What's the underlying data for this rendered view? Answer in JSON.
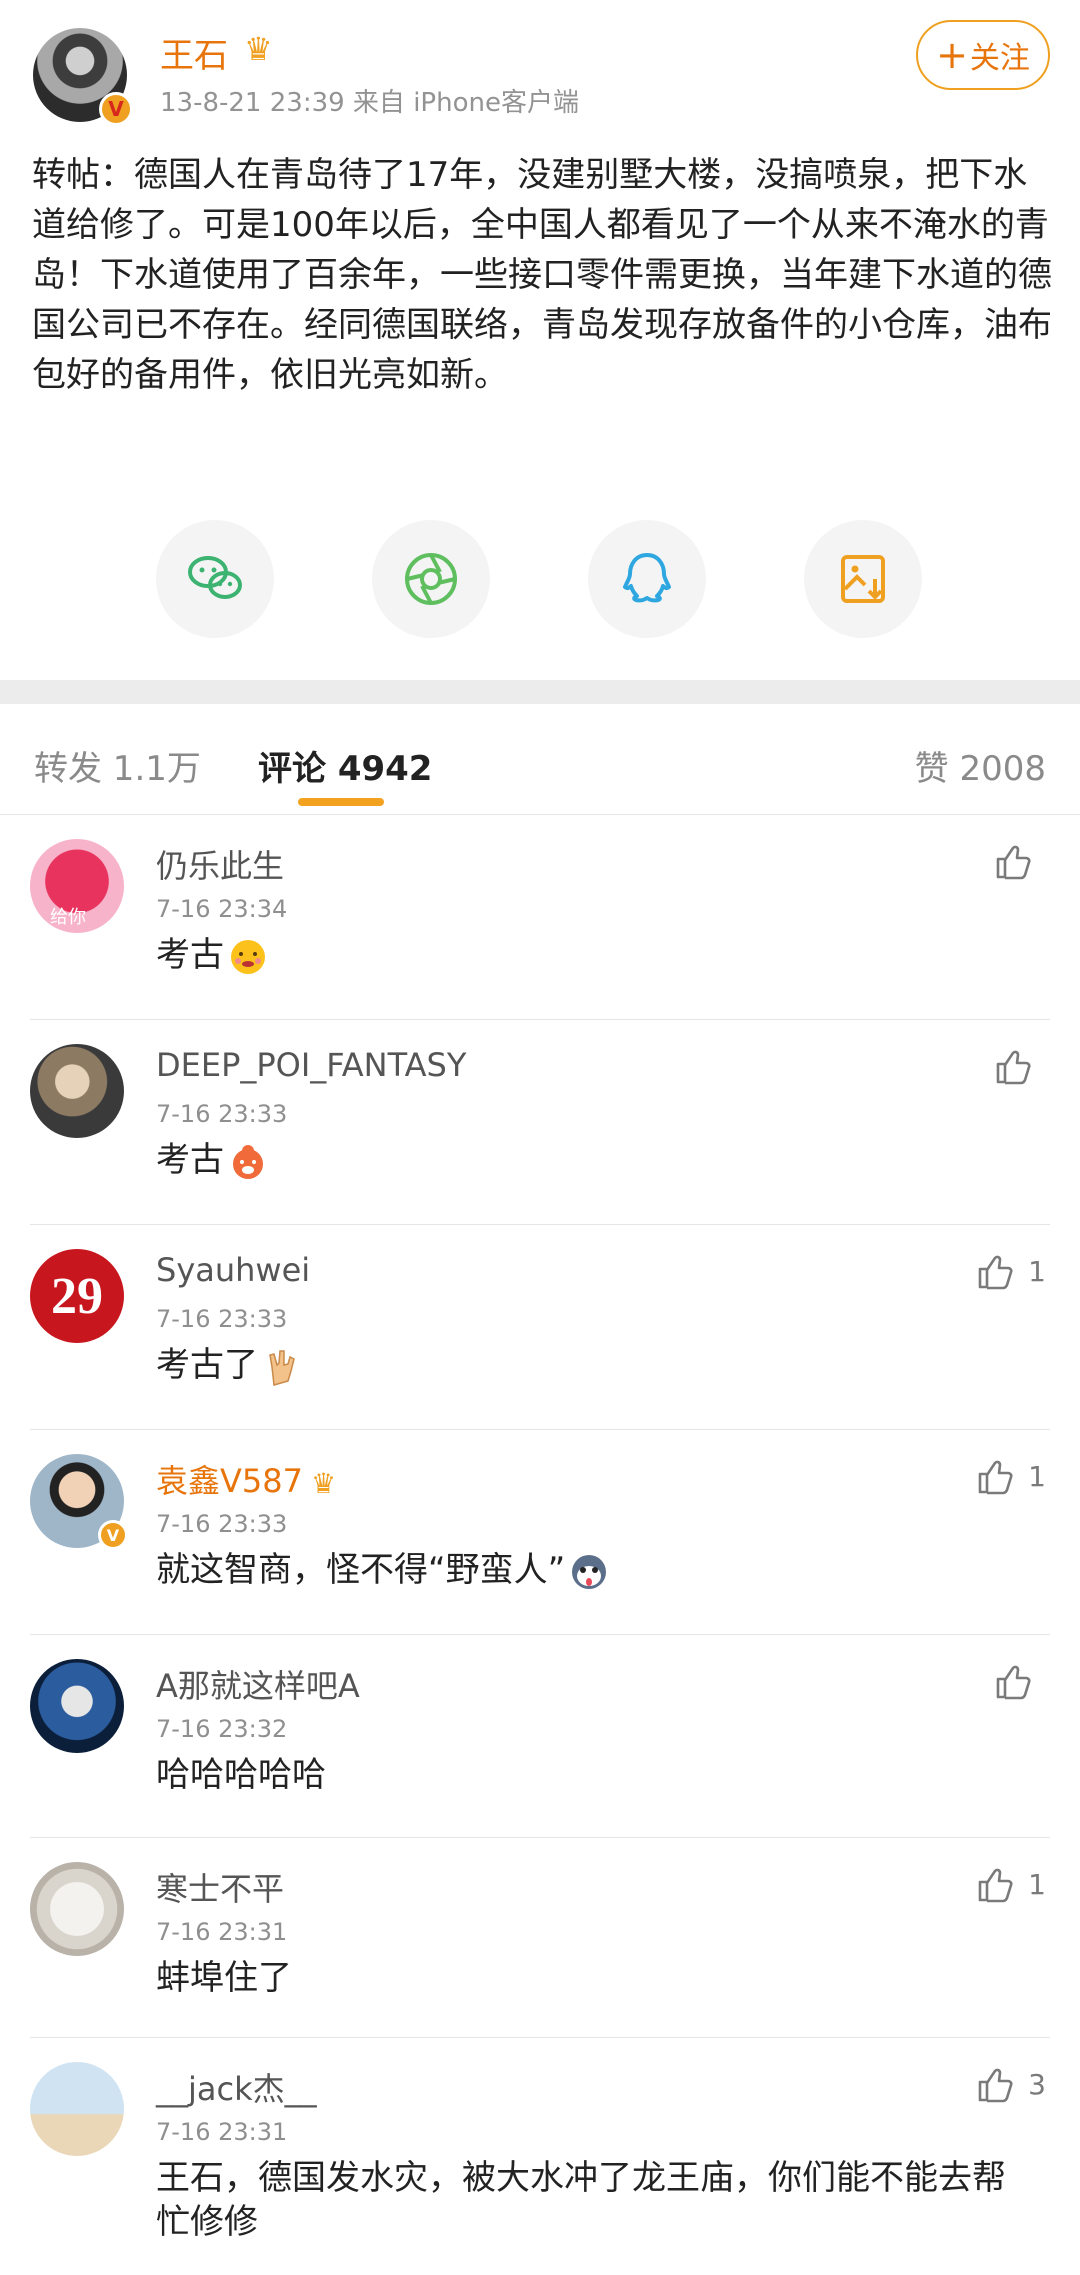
{
  "post": {
    "author": "王石",
    "meta": "13-8-21 23:39  来自 iPhone客户端",
    "follow_label": "关注",
    "text": "转帖：德国人在青岛待了17年，没建别墅大楼，没搞喷泉，把下水道给修了。可是100年以后，全中国人都看见了一个从来不淹水的青岛！下水道使用了百余年，一些接口零件需更换，当年建下水道的德国公司已不存在。经同德国联络，青岛发现存放备件的小仓库，油布包好的备用件，依旧光亮如新。"
  },
  "share": [
    {
      "icon": "wechat-icon",
      "color": "#3cb371"
    },
    {
      "icon": "moments-icon",
      "color": "#5fbf5f"
    },
    {
      "icon": "qq-icon",
      "color": "#2ea7e0"
    },
    {
      "icon": "save-image-icon",
      "color": "#f0a020"
    }
  ],
  "tabs": {
    "repost": "转发 1.1万",
    "comments": "评论 4942",
    "likes": "赞 2008"
  },
  "comments": [
    {
      "name": "仍乐此生",
      "time": "7-16 23:34",
      "text": "考古",
      "likes": ""
    },
    {
      "name": "DEEP_POI_FANTASY",
      "time": "7-16 23:33",
      "text": "考古",
      "likes": ""
    },
    {
      "name": "Syauhwei",
      "time": "7-16 23:33",
      "text": "考古了",
      "likes": "1"
    },
    {
      "name": "袁鑫V587",
      "time": "7-16 23:33",
      "text": "就这智商，怪不得“野蛮人”",
      "likes": "1"
    },
    {
      "name": "A那就这样吧A",
      "time": "7-16 23:32",
      "text": "哈哈哈哈哈",
      "likes": ""
    },
    {
      "name": "寒士不平",
      "time": "7-16 23:31",
      "text": "蚌埠住了",
      "likes": "1"
    },
    {
      "name": "__jack杰__",
      "time": "7-16 23:31",
      "text": "王石，德国发水灾，被大水冲了龙王庙，你们能不能去帮忙修修",
      "likes": "3"
    }
  ],
  "avatar_texts": {
    "c0": "给你",
    "c2": "29"
  },
  "colors": {
    "accent": "#e8740c",
    "tab_indicator": "#f3a220"
  }
}
